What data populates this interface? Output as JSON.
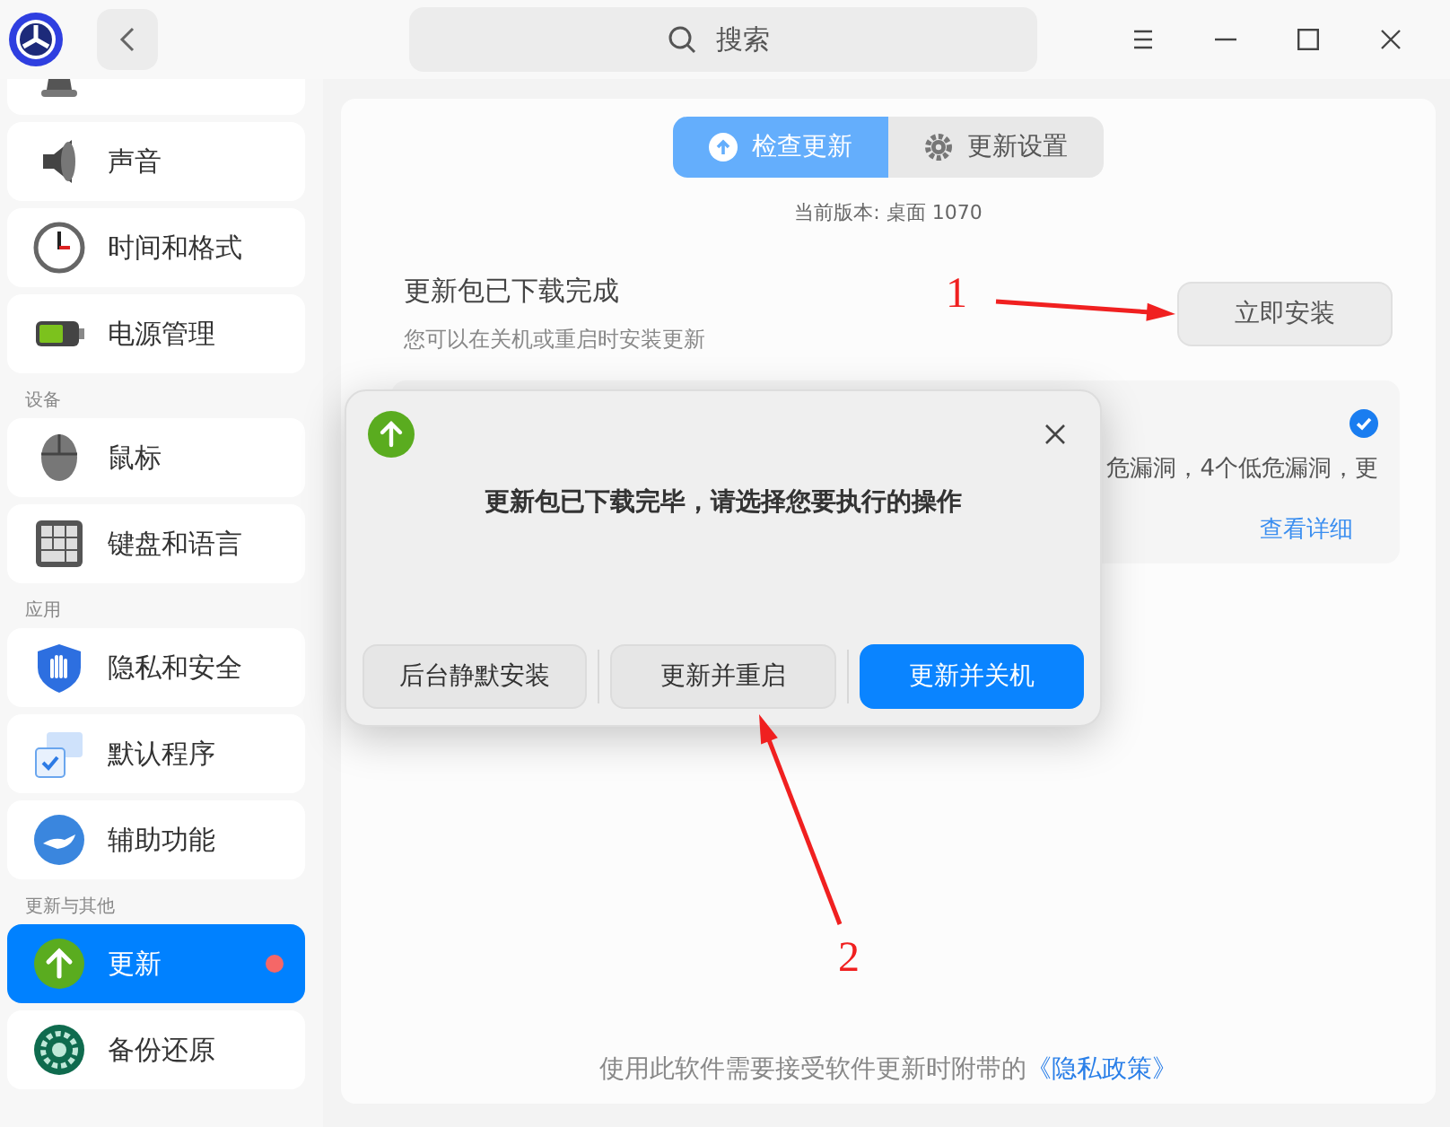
{
  "header": {
    "search": {
      "placeholder": "搜索"
    }
  },
  "sidebar": {
    "sections": [
      {
        "items": [
          {
            "selected": false,
            "badge": false
          },
          {
            "label": "声音",
            "selected": false,
            "badge": false
          },
          {
            "label": "时间和格式",
            "selected": false,
            "badge": false
          },
          {
            "label": "电源管理",
            "selected": false,
            "badge": false
          }
        ]
      },
      {
        "heading": "设备",
        "items": [
          {
            "label": "鼠标",
            "selected": false,
            "badge": false
          },
          {
            "label": "键盘和语言",
            "selected": false,
            "badge": false
          }
        ]
      },
      {
        "heading": "应用",
        "items": [
          {
            "label": "隐私和安全",
            "selected": false,
            "badge": false
          },
          {
            "label": "默认程序",
            "selected": false,
            "badge": false
          },
          {
            "label": "辅助功能",
            "selected": false,
            "badge": false
          }
        ]
      },
      {
        "heading": "更新与其他",
        "items": [
          {
            "label": "更新",
            "selected": true,
            "badge": true
          },
          {
            "label": "备份还原",
            "selected": false,
            "badge": false
          }
        ]
      }
    ]
  },
  "tabs": [
    {
      "label": "检查更新",
      "selected": true
    },
    {
      "label": "更新设置",
      "selected": false
    }
  ],
  "version": "当前版本: 桌面 1070",
  "status": {
    "title": "更新包已下载完成",
    "subtitle": "您可以在关机或重启时安装更新",
    "button": "立即安装"
  },
  "update_card": {
    "checked": true,
    "text": "危漏洞，4个低危漏洞，更",
    "link": "查看详细"
  },
  "footer": {
    "text": "使用此软件需要接受软件更新时附带的",
    "link": "《隐私政策》"
  },
  "dialog": {
    "message": "更新包已下载完毕，请选择您要执行的操作",
    "buttons": [
      {
        "label": "后台静默安装",
        "primary": false
      },
      {
        "label": "更新并重启",
        "primary": false
      },
      {
        "label": "更新并关机",
        "primary": true
      }
    ]
  },
  "annotations": [
    {
      "label": "1"
    },
    {
      "label": "2"
    }
  ]
}
